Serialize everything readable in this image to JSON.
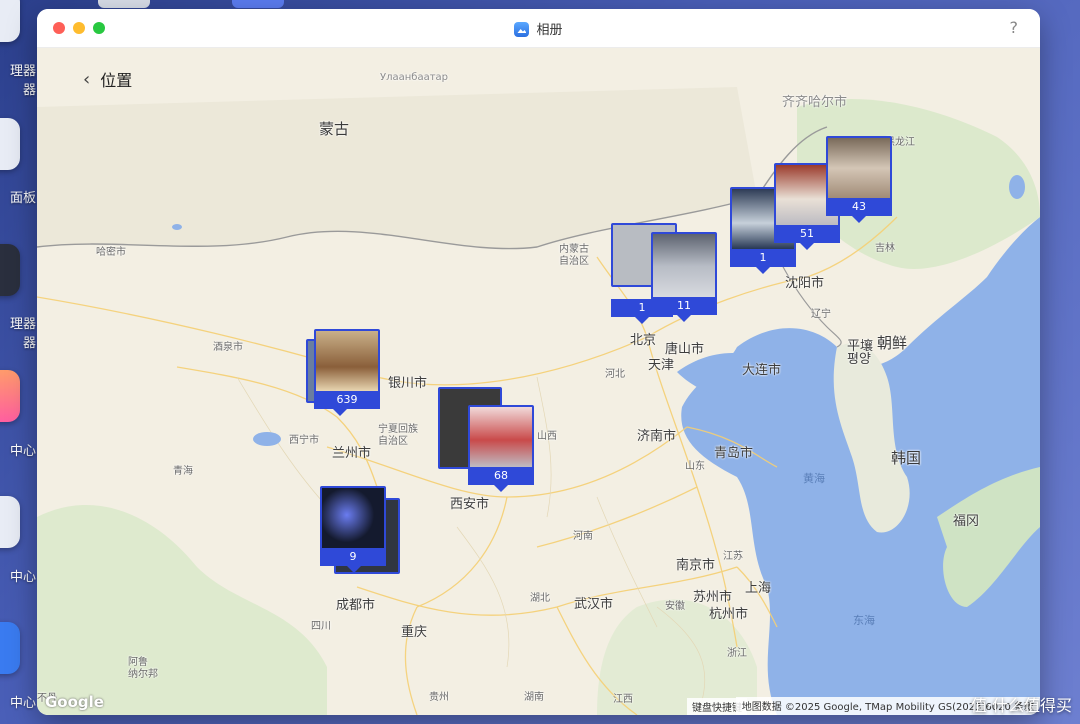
{
  "desktop": {
    "dock_labels": [
      "理器器",
      "面板",
      "理器器",
      "中心",
      "中心",
      "中心"
    ]
  },
  "window": {
    "title": "相册",
    "help": "?"
  },
  "nav": {
    "back_label": "位置"
  },
  "map": {
    "labels": {
      "ulaanbaatar": "Улаанбаатар",
      "mongolia": "蒙古",
      "qiqihar": "齐齐哈尔市",
      "heilongjiang": "黑龙江",
      "jilin": "吉林",
      "hami": "哈密市",
      "inner_mongolia": "内蒙古\n自治区",
      "shenyang": "沈阳市",
      "liaoning": "辽宁",
      "jiuquan": "酒泉市",
      "yinchuan": "银川市",
      "beijing": "北京",
      "tangshan": "唐山市",
      "tianjin": "天津",
      "hebei": "河北",
      "pyongyang": "平壤\n평양",
      "north_korea": "朝鲜",
      "dalian": "大连市",
      "xining": "西宁市",
      "lanzhou": "兰州市",
      "ningxia": "宁夏回族\n自治区",
      "shanxi": "山西",
      "jinan": "济南市",
      "qingdao": "青岛市",
      "shandong": "山东",
      "korea": "韩国",
      "yellow_sea": "黄海",
      "qinghai": "青海",
      "xian": "西安市",
      "henan": "河南",
      "fukuoka": "福冈",
      "nanjing": "南京市",
      "jiangsu": "江苏",
      "suzhou": "苏州市",
      "shanghai": "上海",
      "hubei": "湖北",
      "anhui": "安徽",
      "wuhan": "武汉市",
      "hangzhou": "杭州市",
      "east_sea": "东海",
      "chengdu": "成都市",
      "sichuan": "四川",
      "chongqing": "重庆",
      "zhejiang": "浙江",
      "aru": "阿鲁\n纳尔邦",
      "guizhou": "贵州",
      "hunan": "湖南",
      "jiangxi": "江西",
      "bhutan": "不丹"
    },
    "clusters": [
      {
        "id": "gansu",
        "count": "639"
      },
      {
        "id": "shaanxi",
        "count": "68"
      },
      {
        "id": "sichuan",
        "count": "9"
      },
      {
        "id": "beijing-a",
        "count": "1"
      },
      {
        "id": "beijing-b",
        "count": "11"
      },
      {
        "id": "liaoning-a",
        "count": "1"
      },
      {
        "id": "liaoning-b",
        "count": "51"
      },
      {
        "id": "jilin",
        "count": "43"
      }
    ],
    "keyboard_shortcuts": "键盘快捷键",
    "attribution": "地图数据 ©2025 Google, TMap Mobility GS(2023)6020 条款",
    "google_logo": "Google"
  },
  "watermark": "值·什么值得买",
  "colors": {
    "accent": "#2f49d8",
    "sea": "#8fb2e8",
    "land": "#f3efe3",
    "road": "#f5cf73"
  }
}
